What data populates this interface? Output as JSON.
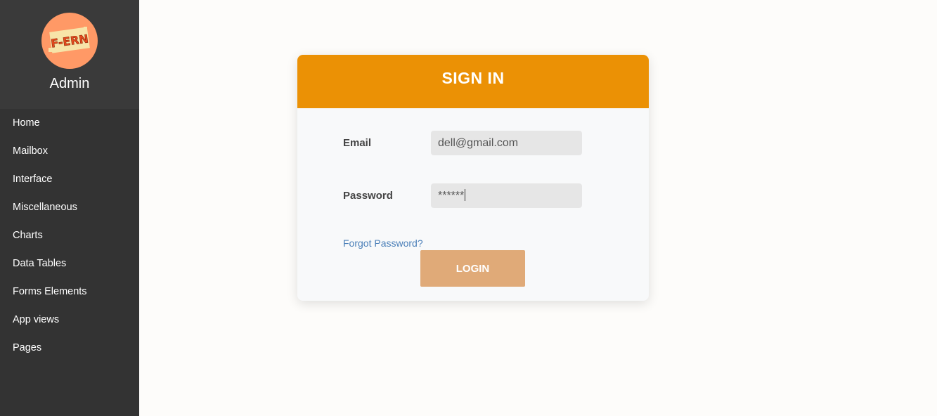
{
  "sidebar": {
    "logo_text": "F-ERN",
    "admin_name": "Admin",
    "items": [
      {
        "label": "Home"
      },
      {
        "label": "Mailbox"
      },
      {
        "label": "Interface"
      },
      {
        "label": "Miscellaneous"
      },
      {
        "label": "Charts"
      },
      {
        "label": "Data Tables"
      },
      {
        "label": "Forms Elements"
      },
      {
        "label": "App views"
      },
      {
        "label": "Pages"
      }
    ]
  },
  "signin": {
    "title": "SIGN IN",
    "email_label": "Email",
    "email_value": "dell@gmail.com",
    "password_label": "Password",
    "password_value": "******",
    "forgot_label": "Forgot Password?",
    "login_label": "LOGIN"
  },
  "colors": {
    "sidebar_bg": "#333333",
    "header_accent": "#eb9105",
    "login_button": "#e0aa78",
    "link": "#4a7fb8"
  }
}
